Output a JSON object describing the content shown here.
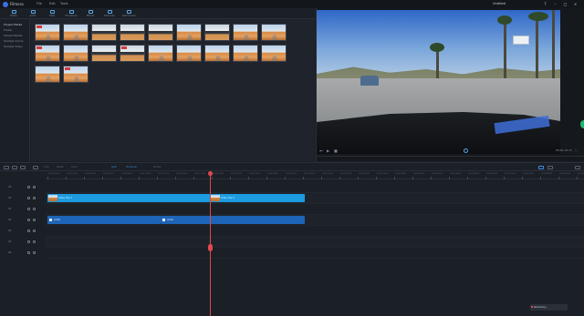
{
  "titlebar": {
    "app_name": "Filmora",
    "menus": [
      "File",
      "Edit",
      "Tools",
      "View",
      "Export",
      "Help"
    ],
    "right_label": "Untitled"
  },
  "media_toolbar": {
    "tools": [
      {
        "label": "Media",
        "icon": "folder-icon"
      },
      {
        "label": "Audio",
        "icon": "music-icon"
      },
      {
        "label": "Titles",
        "icon": "text-icon"
      },
      {
        "label": "Transitions",
        "icon": "transition-icon"
      },
      {
        "label": "Effects",
        "icon": "effects-icon"
      },
      {
        "label": "Elements",
        "icon": "elements-icon"
      },
      {
        "label": "Split Screen",
        "icon": "split-icon"
      }
    ]
  },
  "categories": [
    {
      "label": "Project Media",
      "active": true
    },
    {
      "label": "Folder",
      "active": false
    },
    {
      "label": "Shared Media",
      "active": false
    },
    {
      "label": "Sample Colors",
      "active": false
    },
    {
      "label": "Sample Video",
      "active": false
    }
  ],
  "media_items": [
    {
      "tag": true,
      "style": "desert"
    },
    {
      "tag": false,
      "style": "desert"
    },
    {
      "tag": false,
      "style": "dark"
    },
    {
      "tag": false,
      "style": "dark"
    },
    {
      "tag": true,
      "style": "dark"
    },
    {
      "tag": false,
      "style": "desert"
    },
    {
      "tag": false,
      "style": "dark"
    },
    {
      "tag": true,
      "style": "desert"
    },
    {
      "tag": false,
      "style": "desert"
    },
    {
      "tag": false,
      "style": "desert"
    },
    {
      "tag": false,
      "style": "desert"
    },
    {
      "tag": true,
      "style": "desert"
    },
    {
      "tag": false,
      "style": "desert"
    },
    {
      "tag": false,
      "style": "desert"
    },
    {
      "tag": false,
      "style": "desert"
    },
    {
      "tag": true,
      "style": "desert"
    }
  ],
  "preview": {
    "timecode": "00:00:10:12",
    "icons": [
      "prev-frame-icon",
      "play-icon",
      "stop-icon",
      "snapshot-icon",
      "volume-icon",
      "fullscreen-icon"
    ]
  },
  "timeline_toolbar": {
    "buttons": [
      "Undo",
      "Redo",
      "Delete",
      "Cut",
      "Crop",
      "Speed",
      "Color",
      "Split",
      "Voiceover",
      "Marker"
    ]
  },
  "ruler_labels": [
    "00:00:00:00",
    "00:00:02:00",
    "00:00:04:00",
    "00:00:06:00",
    "00:00:08:00",
    "00:00:10:00",
    "00:00:12:00",
    "00:00:14:00",
    "00:00:16:00",
    "00:00:18:00",
    "00:00:20:00",
    "00:00:22:00",
    "00:00:24:00",
    "00:00:26:00",
    "00:00:28:00",
    "00:00:30:00",
    "00:00:32:00",
    "00:00:34:00",
    "00:00:36:00",
    "00:00:38:00",
    "00:00:40:00",
    "00:00:42:00",
    "00:00:44:00",
    "00:00:46:00",
    "00:00:48:00",
    "00:00:50:00",
    "00:00:52:00",
    "00:00:54:00",
    "00:00:56:00",
    "00:00:58:00"
  ],
  "tracks": [
    {
      "name": "V3"
    },
    {
      "name": "V2"
    },
    {
      "name": "V1"
    },
    {
      "name": "A1"
    },
    {
      "name": "A2"
    },
    {
      "name": "A3"
    },
    {
      "name": "A4"
    }
  ],
  "clips": {
    "video_a": "Video Clip 1",
    "video_b": "Video Clip 2",
    "audio_a": "Audio",
    "audio_b": "Audio"
  },
  "status_badge": "Rendering..."
}
